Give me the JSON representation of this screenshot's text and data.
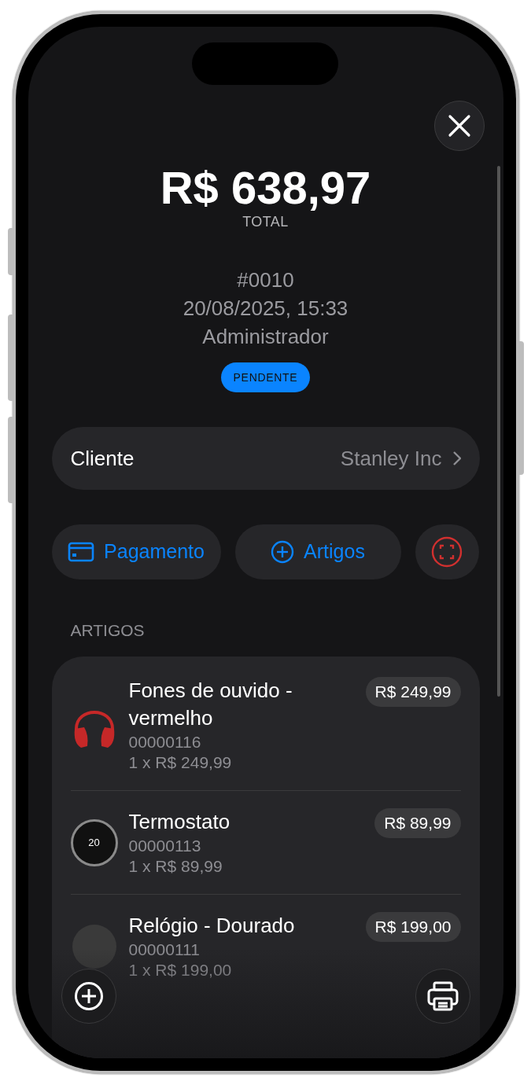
{
  "total": {
    "amount": "R$ 638,97",
    "label": "TOTAL"
  },
  "order": {
    "number": "#0010",
    "datetime": "20/08/2025, 15:33",
    "user": "Administrador",
    "status": "PENDENTE"
  },
  "customer": {
    "label": "Cliente",
    "value": "Stanley Inc"
  },
  "actions": [
    {
      "kind": "payment",
      "label": "Pagamento"
    },
    {
      "kind": "add",
      "label": "Artigos"
    },
    {
      "kind": "scan"
    }
  ],
  "items_section": {
    "title": "ARTIGOS"
  },
  "items": [
    {
      "kind": "headphones",
      "name": "Fones de ouvido - vermelho",
      "code": "00000116",
      "quantity": "1 x R$ 249,99",
      "price": "R$ 249,99"
    },
    {
      "kind": "thermostat",
      "name": "Termostato",
      "thumb_text": "20",
      "code": "00000113",
      "quantity": "1 x R$ 89,99",
      "price": "R$ 89,99"
    },
    {
      "kind": "watch",
      "name": "Relógio - Dourado",
      "code": "00000111",
      "quantity": "1 x R$ 199,00",
      "price": "R$ 199,00"
    }
  ]
}
